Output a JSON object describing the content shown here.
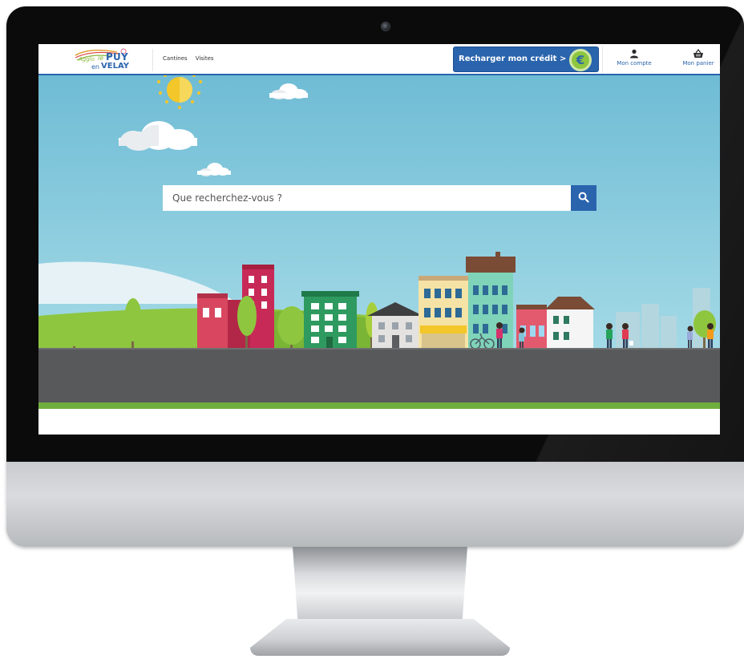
{
  "header": {
    "logo": {
      "agglo": "Agglo",
      "le": "le",
      "puy": "PUY",
      "en": "en",
      "velay": "VELAY"
    },
    "nav": [
      {
        "label": "Cantines"
      },
      {
        "label": "Visites"
      }
    ],
    "credit_button": {
      "label": "Recharger mon crédit >",
      "icon": "euro-coin-icon",
      "symbol": "€"
    },
    "account": {
      "label": "Mon compte",
      "icon": "user-icon"
    },
    "cart": {
      "label": "Mon panier",
      "icon": "basket-icon"
    }
  },
  "search": {
    "placeholder": "Que recherchez-vous ?",
    "value": "",
    "icon": "search-icon"
  },
  "colors": {
    "brand_blue": "#2a64ad",
    "accent_green": "#8ec63f",
    "sky": "#7cc8dc",
    "road": "#58595b"
  }
}
